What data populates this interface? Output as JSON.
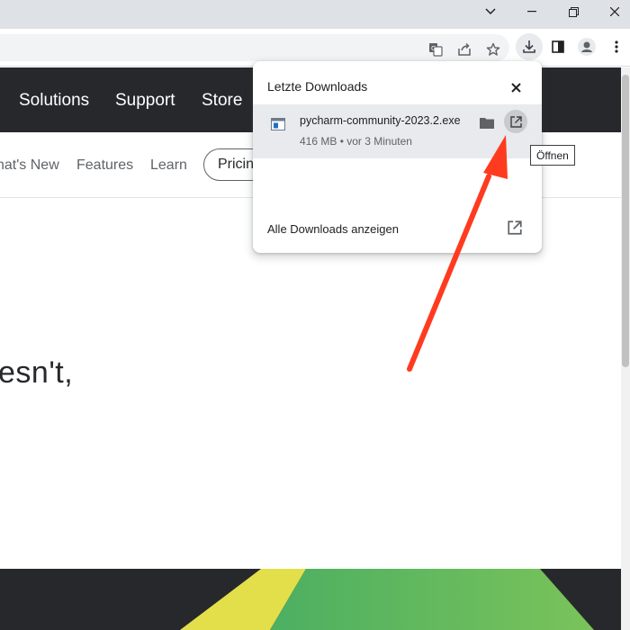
{
  "window_controls": [
    {
      "name": "tab-search-button",
      "icon": "chevron-down-icon"
    },
    {
      "name": "minimize-button",
      "icon": "minimize-icon"
    },
    {
      "name": "restore-button",
      "icon": "restore-icon"
    },
    {
      "name": "close-window-button",
      "icon": "close-icon"
    }
  ],
  "toolbar_icons": [
    "translate-icon",
    "share-icon",
    "bookmark-star-icon",
    "download-icon",
    "side-panel-icon",
    "profile-icon",
    "more-menu-icon"
  ],
  "site_nav": {
    "items": [
      "Solutions",
      "Support",
      "Store"
    ]
  },
  "sub_nav": {
    "whats_new": "nat's New",
    "features": "Features",
    "learn": "Learn",
    "pricing": "Pricin"
  },
  "hero": {
    "headline_fragment": "esn't,"
  },
  "downloads": {
    "title": "Letzte Downloads",
    "items": [
      {
        "filename": "pycharm-community-2023.2.exe",
        "status": "416 MB • vor 3 Minuten"
      }
    ],
    "show_all": "Alle Downloads anzeigen"
  },
  "tooltip": {
    "text": "Öffnen"
  },
  "colors": {
    "nav_background": "#27282c",
    "arrow": "#ff3b1f",
    "footer_yellow": "#e5e04a",
    "footer_green": "#5db86a"
  }
}
